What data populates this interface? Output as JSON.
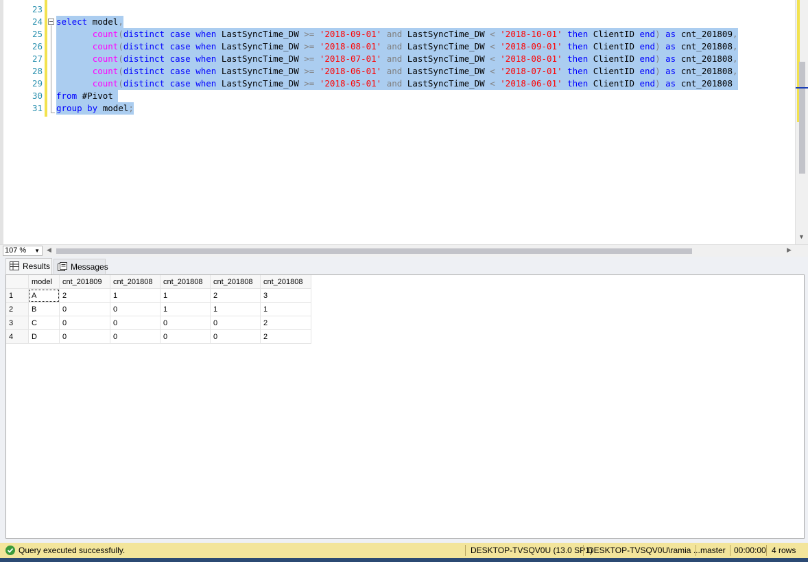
{
  "editor": {
    "lines": [
      {
        "num": "23",
        "selected": false,
        "tokens": []
      },
      {
        "num": "24",
        "selected": true,
        "tokens": [
          {
            "t": "kw",
            "v": "select"
          },
          {
            "t": "id",
            "v": " model"
          },
          {
            "t": "op",
            "v": ","
          }
        ]
      },
      {
        "num": "25",
        "selected": true,
        "tokens": [
          {
            "t": "id",
            "v": "       "
          },
          {
            "t": "fn",
            "v": "count"
          },
          {
            "t": "op",
            "v": "("
          },
          {
            "t": "kw",
            "v": "distinct case when"
          },
          {
            "t": "id",
            "v": " LastSyncTime_DW "
          },
          {
            "t": "op",
            "v": ">="
          },
          {
            "t": "id",
            "v": " "
          },
          {
            "t": "str",
            "v": "'2018-09-01'"
          },
          {
            "t": "id",
            "v": " "
          },
          {
            "t": "op",
            "v": "and"
          },
          {
            "t": "id",
            "v": " LastSyncTime_DW "
          },
          {
            "t": "op",
            "v": "<"
          },
          {
            "t": "id",
            "v": " "
          },
          {
            "t": "str",
            "v": "'2018-10-01'"
          },
          {
            "t": "id",
            "v": " "
          },
          {
            "t": "kw",
            "v": "then"
          },
          {
            "t": "id",
            "v": " ClientID "
          },
          {
            "t": "kw",
            "v": "end"
          },
          {
            "t": "op",
            "v": ")"
          },
          {
            "t": "id",
            "v": " "
          },
          {
            "t": "kw",
            "v": "as"
          },
          {
            "t": "id",
            "v": " cnt_201809"
          },
          {
            "t": "op",
            "v": ","
          }
        ]
      },
      {
        "num": "26",
        "selected": true,
        "tokens": [
          {
            "t": "id",
            "v": "       "
          },
          {
            "t": "fn",
            "v": "count"
          },
          {
            "t": "op",
            "v": "("
          },
          {
            "t": "kw",
            "v": "distinct case when"
          },
          {
            "t": "id",
            "v": " LastSyncTime_DW "
          },
          {
            "t": "op",
            "v": ">="
          },
          {
            "t": "id",
            "v": " "
          },
          {
            "t": "str",
            "v": "'2018-08-01'"
          },
          {
            "t": "id",
            "v": " "
          },
          {
            "t": "op",
            "v": "and"
          },
          {
            "t": "id",
            "v": " LastSyncTime_DW "
          },
          {
            "t": "op",
            "v": "<"
          },
          {
            "t": "id",
            "v": " "
          },
          {
            "t": "str",
            "v": "'2018-09-01'"
          },
          {
            "t": "id",
            "v": " "
          },
          {
            "t": "kw",
            "v": "then"
          },
          {
            "t": "id",
            "v": " ClientID "
          },
          {
            "t": "kw",
            "v": "end"
          },
          {
            "t": "op",
            "v": ")"
          },
          {
            "t": "id",
            "v": " "
          },
          {
            "t": "kw",
            "v": "as"
          },
          {
            "t": "id",
            "v": " cnt_201808"
          },
          {
            "t": "op",
            "v": ","
          }
        ]
      },
      {
        "num": "27",
        "selected": true,
        "tokens": [
          {
            "t": "id",
            "v": "       "
          },
          {
            "t": "fn",
            "v": "count"
          },
          {
            "t": "op",
            "v": "("
          },
          {
            "t": "kw",
            "v": "distinct case when"
          },
          {
            "t": "id",
            "v": " LastSyncTime_DW "
          },
          {
            "t": "op",
            "v": ">="
          },
          {
            "t": "id",
            "v": " "
          },
          {
            "t": "str",
            "v": "'2018-07-01'"
          },
          {
            "t": "id",
            "v": " "
          },
          {
            "t": "op",
            "v": "and"
          },
          {
            "t": "id",
            "v": " LastSyncTime_DW "
          },
          {
            "t": "op",
            "v": "<"
          },
          {
            "t": "id",
            "v": " "
          },
          {
            "t": "str",
            "v": "'2018-08-01'"
          },
          {
            "t": "id",
            "v": " "
          },
          {
            "t": "kw",
            "v": "then"
          },
          {
            "t": "id",
            "v": " ClientID "
          },
          {
            "t": "kw",
            "v": "end"
          },
          {
            "t": "op",
            "v": ")"
          },
          {
            "t": "id",
            "v": " "
          },
          {
            "t": "kw",
            "v": "as"
          },
          {
            "t": "id",
            "v": " cnt_201808"
          },
          {
            "t": "op",
            "v": ","
          }
        ]
      },
      {
        "num": "28",
        "selected": true,
        "tokens": [
          {
            "t": "id",
            "v": "       "
          },
          {
            "t": "fn",
            "v": "count"
          },
          {
            "t": "op",
            "v": "("
          },
          {
            "t": "kw",
            "v": "distinct case when"
          },
          {
            "t": "id",
            "v": " LastSyncTime_DW "
          },
          {
            "t": "op",
            "v": ">="
          },
          {
            "t": "id",
            "v": " "
          },
          {
            "t": "str",
            "v": "'2018-06-01'"
          },
          {
            "t": "id",
            "v": " "
          },
          {
            "t": "op",
            "v": "and"
          },
          {
            "t": "id",
            "v": " LastSyncTime_DW "
          },
          {
            "t": "op",
            "v": "<"
          },
          {
            "t": "id",
            "v": " "
          },
          {
            "t": "str",
            "v": "'2018-07-01'"
          },
          {
            "t": "id",
            "v": " "
          },
          {
            "t": "kw",
            "v": "then"
          },
          {
            "t": "id",
            "v": " ClientID "
          },
          {
            "t": "kw",
            "v": "end"
          },
          {
            "t": "op",
            "v": ")"
          },
          {
            "t": "id",
            "v": " "
          },
          {
            "t": "kw",
            "v": "as"
          },
          {
            "t": "id",
            "v": " cnt_201808"
          },
          {
            "t": "op",
            "v": ","
          }
        ]
      },
      {
        "num": "29",
        "selected": true,
        "tokens": [
          {
            "t": "id",
            "v": "       "
          },
          {
            "t": "fn",
            "v": "count"
          },
          {
            "t": "op",
            "v": "("
          },
          {
            "t": "kw",
            "v": "distinct case when"
          },
          {
            "t": "id",
            "v": " LastSyncTime_DW "
          },
          {
            "t": "op",
            "v": ">="
          },
          {
            "t": "id",
            "v": " "
          },
          {
            "t": "str",
            "v": "'2018-05-01'"
          },
          {
            "t": "id",
            "v": " "
          },
          {
            "t": "op",
            "v": "and"
          },
          {
            "t": "id",
            "v": " LastSyncTime_DW "
          },
          {
            "t": "op",
            "v": "<"
          },
          {
            "t": "id",
            "v": " "
          },
          {
            "t": "str",
            "v": "'2018-06-01'"
          },
          {
            "t": "id",
            "v": " "
          },
          {
            "t": "kw",
            "v": "then"
          },
          {
            "t": "id",
            "v": " ClientID "
          },
          {
            "t": "kw",
            "v": "end"
          },
          {
            "t": "op",
            "v": ")"
          },
          {
            "t": "id",
            "v": " "
          },
          {
            "t": "kw",
            "v": "as"
          },
          {
            "t": "id",
            "v": " cnt_201808 "
          }
        ]
      },
      {
        "num": "30",
        "selected": true,
        "tokens": [
          {
            "t": "kw",
            "v": "from"
          },
          {
            "t": "id",
            "v": " #Pivot "
          }
        ]
      },
      {
        "num": "31",
        "selected": true,
        "tokens": [
          {
            "t": "kw",
            "v": "group by"
          },
          {
            "t": "id",
            "v": " model"
          },
          {
            "t": "op",
            "v": ";"
          }
        ]
      }
    ],
    "zoom": "107 %",
    "colors": {
      "selection": "#abcdf0",
      "keyword": "#0000ff",
      "function": "#ff00ff",
      "string": "#ff0000",
      "operator": "#808080",
      "line_number": "#2b91af"
    }
  },
  "tabs": {
    "results_label": "Results",
    "messages_label": "Messages"
  },
  "grid": {
    "columns": [
      "model",
      "cnt_201809",
      "cnt_201808",
      "cnt_201808",
      "cnt_201808",
      "cnt_201808"
    ],
    "rows": [
      {
        "num": "1",
        "cells": [
          "A",
          "2",
          "1",
          "1",
          "2",
          "3"
        ]
      },
      {
        "num": "2",
        "cells": [
          "B",
          "0",
          "0",
          "1",
          "1",
          "1"
        ]
      },
      {
        "num": "3",
        "cells": [
          "C",
          "0",
          "0",
          "0",
          "0",
          "2"
        ]
      },
      {
        "num": "4",
        "cells": [
          "D",
          "0",
          "0",
          "0",
          "0",
          "2"
        ]
      }
    ]
  },
  "status": {
    "message": "Query executed successfully.",
    "server": "DESKTOP-TVSQV0U (13.0 SP1)",
    "user": "DESKTOP-TVSQV0U\\ramia ...",
    "database": "master",
    "elapsed": "00:00:00",
    "rows": "4 rows",
    "bar_color": "#f3e59b"
  }
}
